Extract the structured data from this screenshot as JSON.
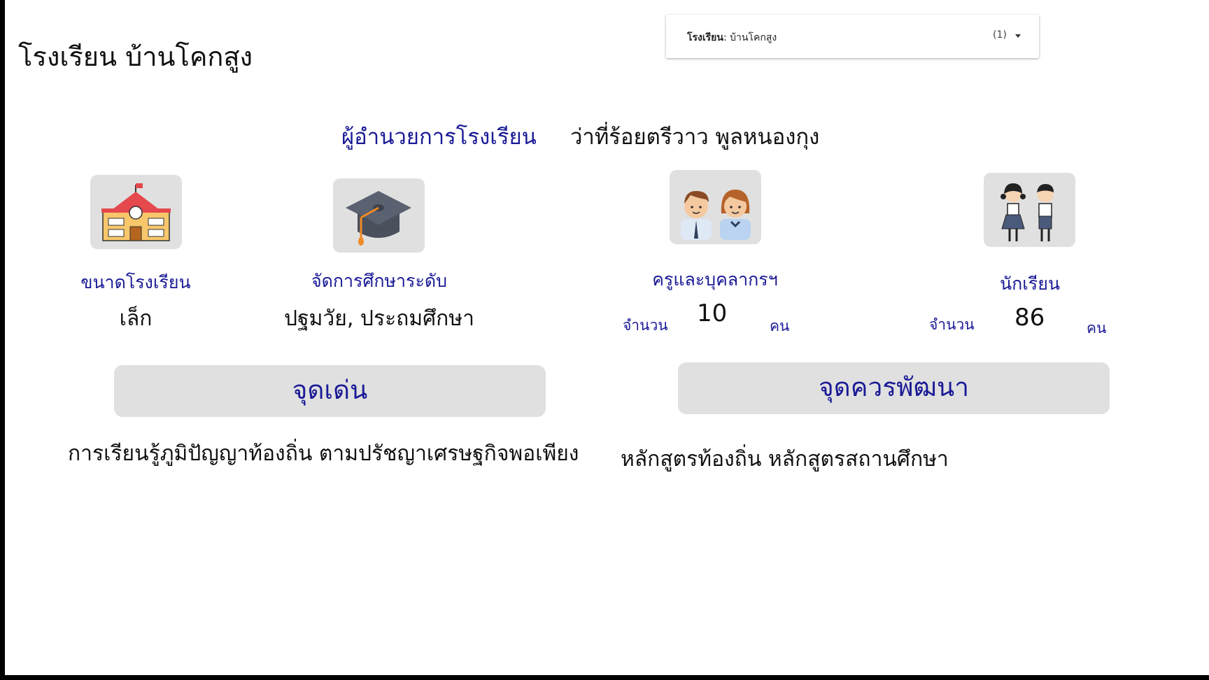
{
  "header": {
    "school_title": "โรงเรียน บ้านโคกสูง"
  },
  "filter": {
    "field_label": "โรงเรียน",
    "field_value": ": บ้านโคกสูง",
    "count": "(1)"
  },
  "director": {
    "label": "ผู้อำนวยการโรงเรียน",
    "name": "ว่าที่ร้อยตรีวาว พูลหนองกุง"
  },
  "stats": {
    "size": {
      "icon": "school-building-icon",
      "label": "ขนาดโรงเรียน",
      "value": "เล็ก"
    },
    "level": {
      "icon": "graduation-cap-icon",
      "label": "จัดการศึกษาระดับ",
      "value": "ปฐมวัย, ประถมศึกษา"
    },
    "teachers": {
      "icon": "teachers-icon",
      "label": "ครูและบุคลากรฯ",
      "count_label": "จำนวน",
      "count": "10",
      "unit": "คน"
    },
    "students": {
      "icon": "students-icon",
      "label": "นักเรียน",
      "count_label": "จำนวน",
      "count": "86",
      "unit": "คน"
    }
  },
  "strengths": {
    "heading": "จุดเด่น",
    "text": "การเรียนรู้ภูมิปัญญาท้องถิ่น ตามปรัชญาเศรษฐกิจพอเพียง"
  },
  "improvements": {
    "heading": "จุดควรพัฒนา",
    "text": "หลักสูตรท้องถิ่น หลักสูตรสถานศึกษา"
  },
  "colors": {
    "accent_blue": "#1a1a96",
    "panel_gray": "#e0e0e0"
  }
}
